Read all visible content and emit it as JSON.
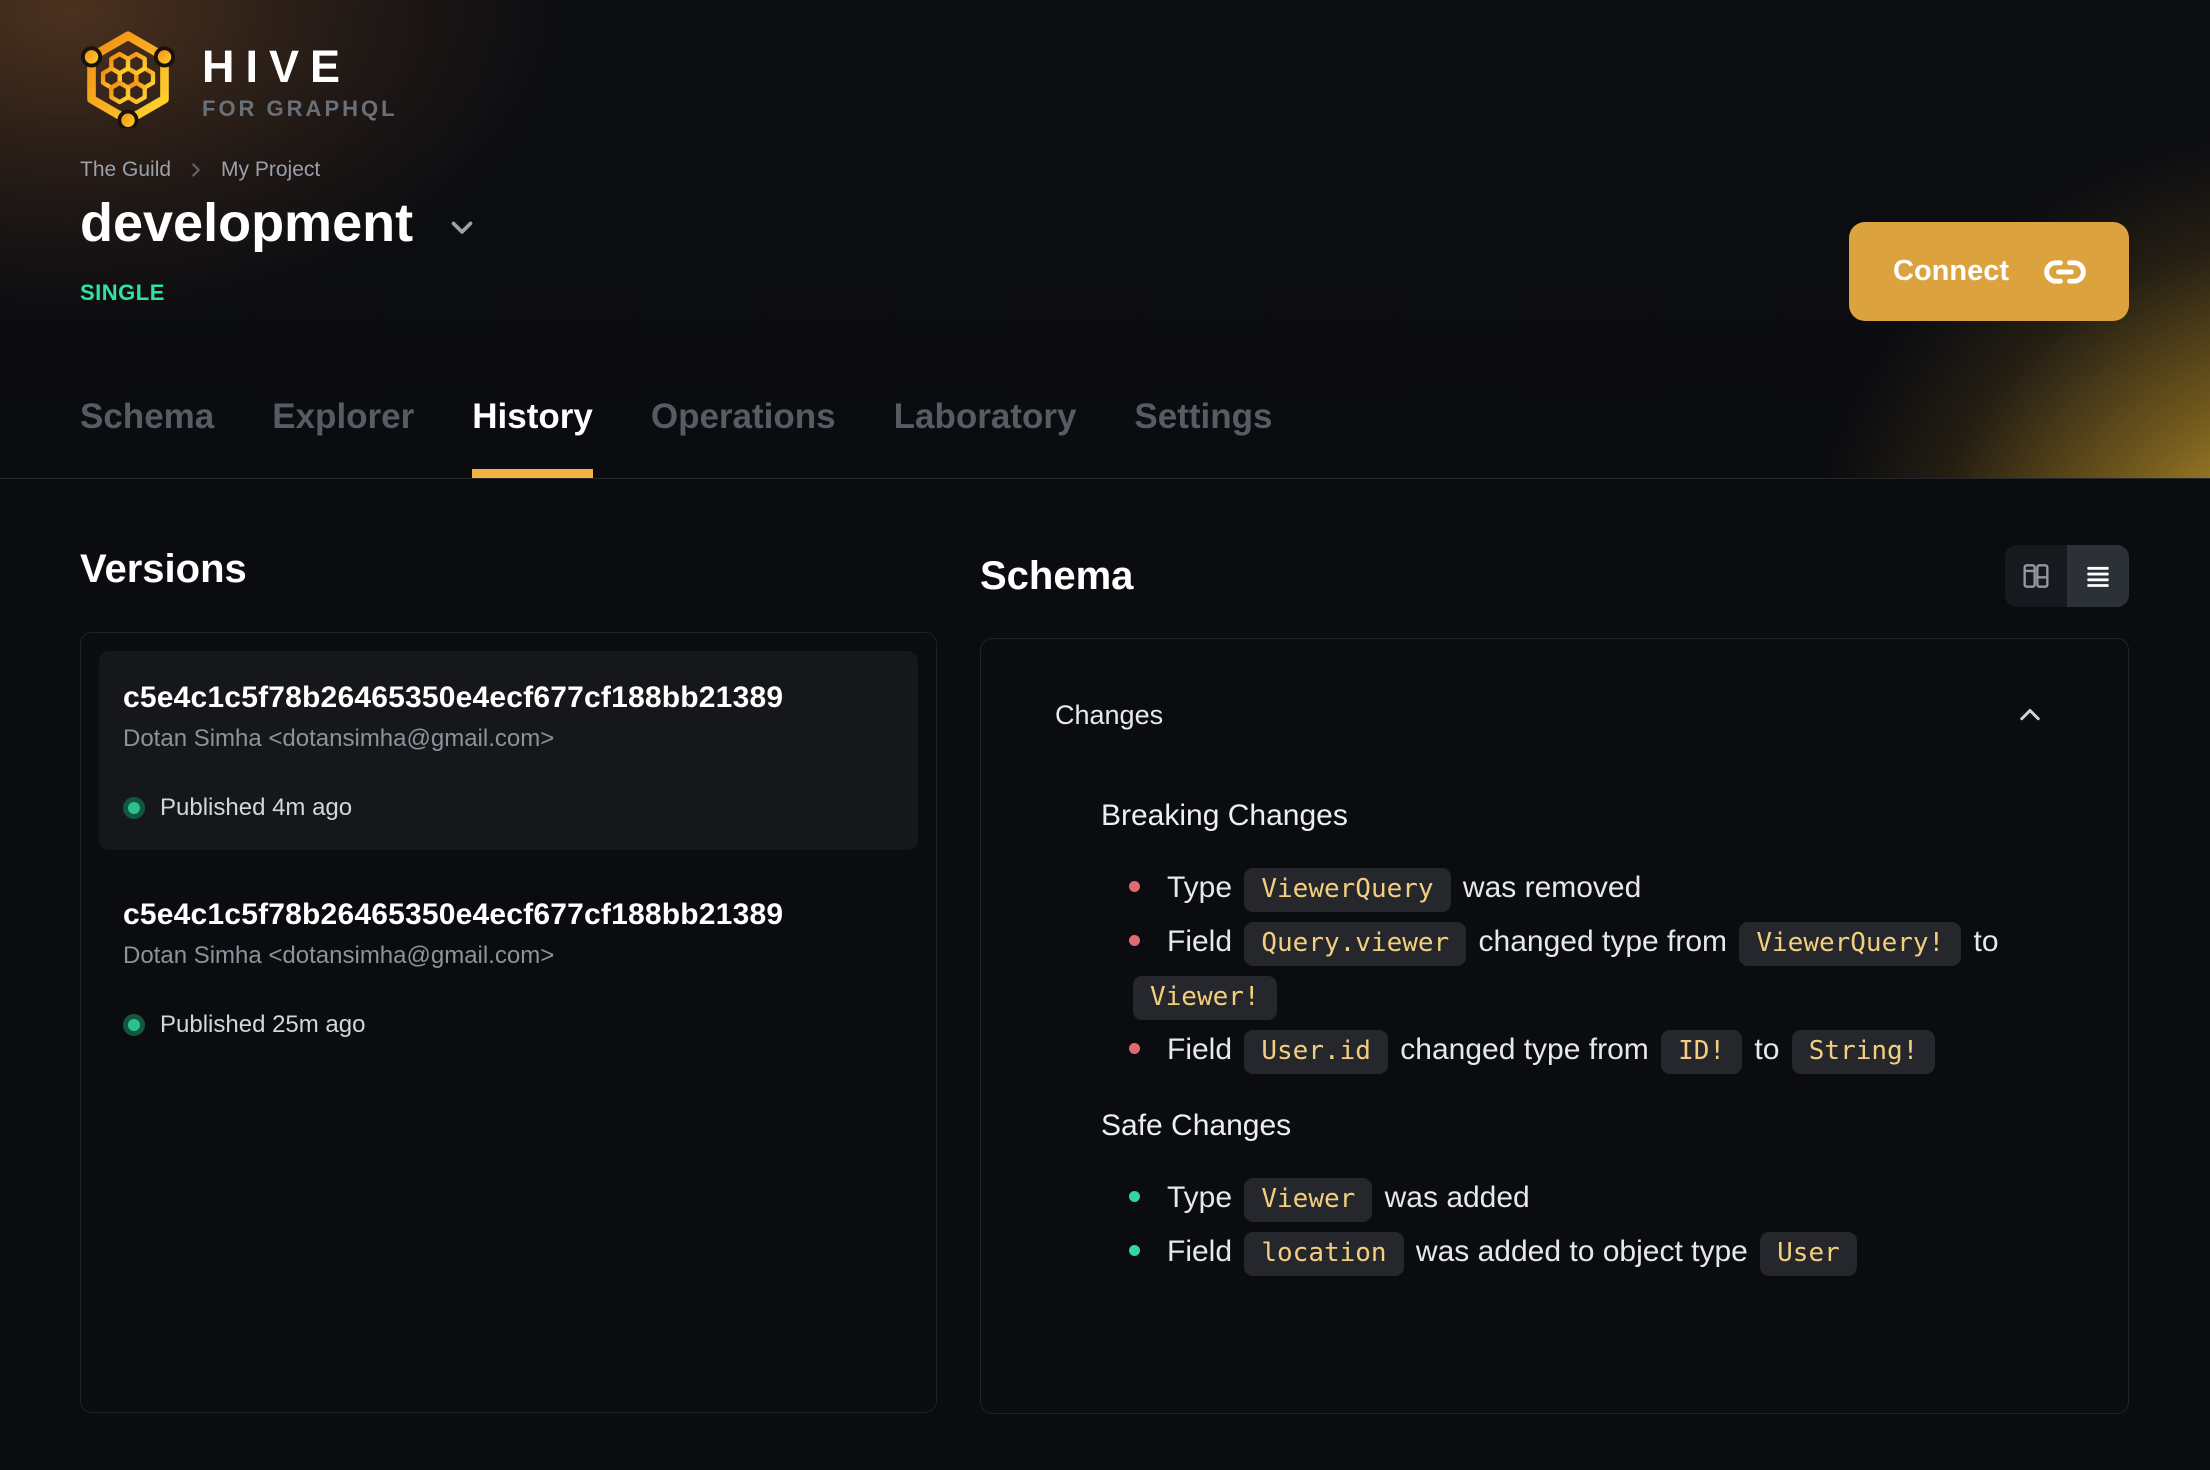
{
  "brand": {
    "name": "HIVE",
    "tagline": "FOR GRAPHQL"
  },
  "breadcrumb": {
    "org": "The Guild",
    "project": "My Project"
  },
  "header": {
    "target_name": "development",
    "badge": "SINGLE",
    "connect_label": "Connect"
  },
  "tabs": [
    {
      "label": "Schema",
      "active": false
    },
    {
      "label": "Explorer",
      "active": false
    },
    {
      "label": "History",
      "active": true
    },
    {
      "label": "Operations",
      "active": false
    },
    {
      "label": "Laboratory",
      "active": false
    },
    {
      "label": "Settings",
      "active": false
    }
  ],
  "versions": {
    "title": "Versions",
    "items": [
      {
        "hash": "c5e4c1c5f78b26465350e4ecf677cf188bb21389",
        "author": "Dotan Simha <dotansimha@gmail.com>",
        "status": "Published 4m ago",
        "selected": true
      },
      {
        "hash": "c5e4c1c5f78b26465350e4ecf677cf188bb21389",
        "author": "Dotan Simha <dotansimha@gmail.com>",
        "status": "Published 25m ago",
        "selected": false
      }
    ]
  },
  "schema_panel": {
    "title": "Schema",
    "changes_label": "Changes",
    "breaking": {
      "title": "Breaking Changes",
      "items": [
        {
          "segments": [
            "Type ",
            "ViewerQuery",
            " was removed"
          ]
        },
        {
          "segments": [
            "Field ",
            "Query.viewer",
            " changed type from ",
            "ViewerQuery!",
            " to ",
            "Viewer!"
          ]
        },
        {
          "segments": [
            "Field ",
            "User.id",
            " changed type from ",
            "ID!",
            " to ",
            "String!"
          ]
        }
      ]
    },
    "safe": {
      "title": "Safe Changes",
      "items": [
        {
          "segments": [
            "Type ",
            "Viewer",
            " was added"
          ]
        },
        {
          "segments": [
            "Field ",
            "location",
            " was added to object type ",
            "User"
          ]
        }
      ]
    }
  },
  "icons": {
    "logo": "hive-honeycomb-hexagon",
    "connect": "link-icon",
    "title_dropdown": "chevron-down-icon",
    "breadcrumb_separator": "chevron-right-icon",
    "view_toggle": [
      "columns-icon",
      "rows-icon"
    ],
    "changes_collapse": "chevron-up-icon",
    "version_status": "green-dot"
  },
  "colors": {
    "background": "#0a0c0f",
    "accent_underline": "#efb441",
    "connect_button": "#dca23e",
    "badge_green": "#2ce5a1",
    "breaking_bullet": "#e16a70",
    "safe_bullet": "#30d6a4",
    "code_text": "#f2cf7e",
    "code_background": "#26272c",
    "panel_border": "#1f2227",
    "selected_card": "#15171b"
  }
}
